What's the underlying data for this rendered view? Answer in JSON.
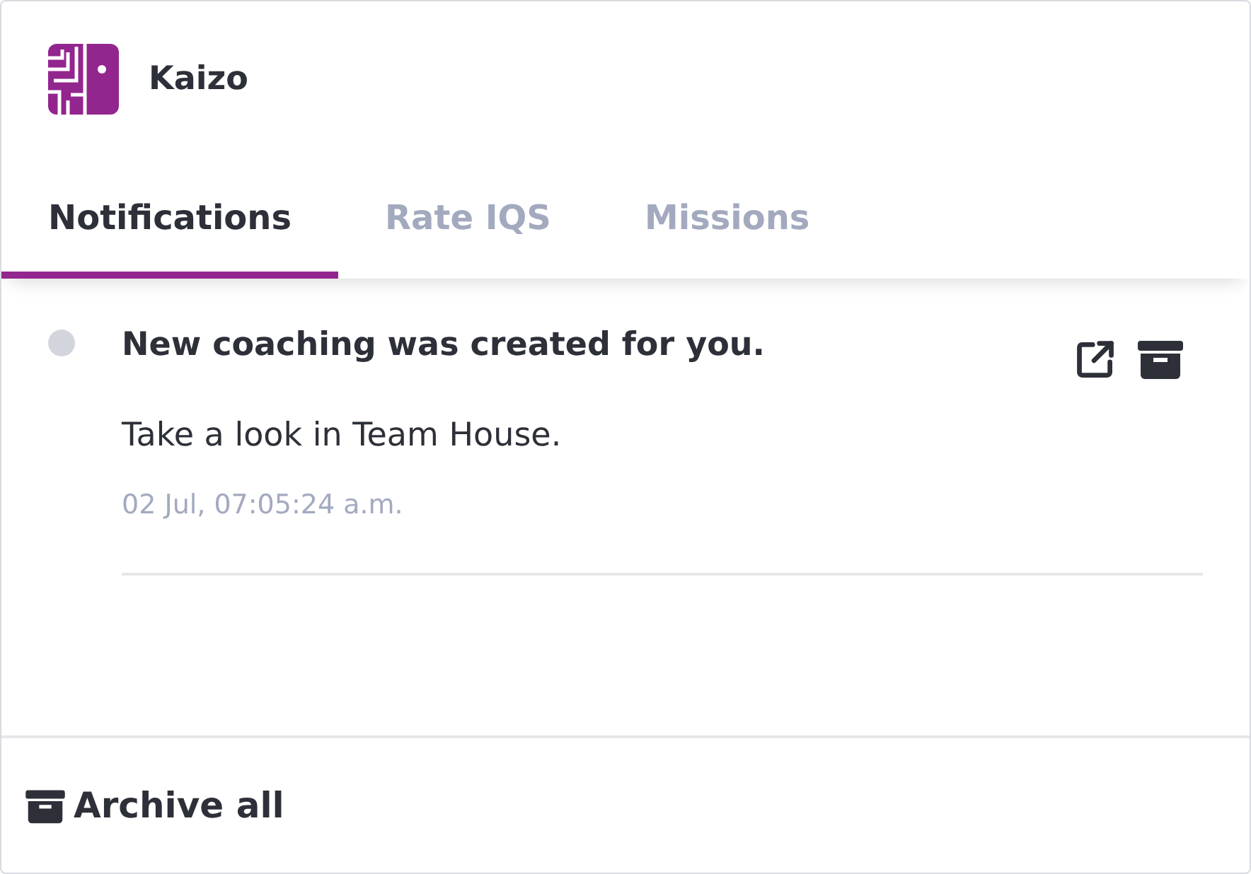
{
  "app": {
    "name": "Kaizo"
  },
  "tabs": [
    {
      "label": "Notifications",
      "selected": true
    },
    {
      "label": "Rate IQS",
      "selected": false
    },
    {
      "label": "Missions",
      "selected": false
    }
  ],
  "notifications": [
    {
      "title": "New coaching was created for you.",
      "body": "Take a look in Team House.",
      "time": "02 Jul, 07:05:24 a.m.",
      "unread": false
    }
  ],
  "footer": {
    "action": "Archive all"
  }
}
